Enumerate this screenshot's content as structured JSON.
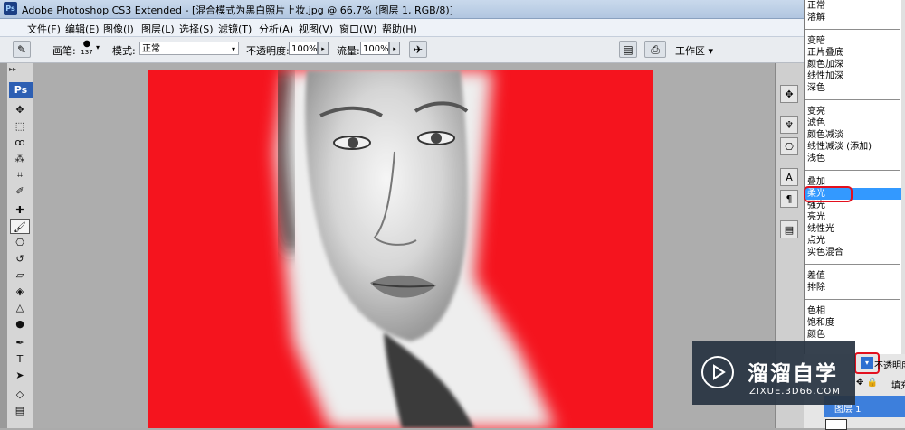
{
  "app": {
    "title": "Adobe Photoshop CS3 Extended - [混合模式为黑白照片上妆.jpg @ 66.7% (图层 1, RGB/8)]",
    "icon_text": "Ps"
  },
  "menu": [
    "文件(F)",
    "编辑(E)",
    "图像(I)",
    "图层(L)",
    "选择(S)",
    "滤镜(T)",
    "分析(A)",
    "视图(V)",
    "窗口(W)",
    "帮助(H)"
  ],
  "options": {
    "brush_label": "画笔:",
    "brush_size": "137",
    "mode_label": "模式:",
    "mode_value": "正常",
    "opacity_label": "不透明度:",
    "opacity_value": "100%",
    "flow_label": "流量:",
    "flow_value": "100%",
    "workspace_label": "工作区 ▾"
  },
  "toolbox": {
    "logo": "Ps",
    "tools": [
      {
        "name": "move-tool-icon",
        "glyph": "✥"
      },
      {
        "name": "marquee-tool-icon",
        "glyph": "⬚"
      },
      {
        "name": "lasso-tool-icon",
        "glyph": "ꝏ"
      },
      {
        "name": "magic-wand-icon",
        "glyph": "⁂"
      },
      {
        "name": "crop-tool-icon",
        "glyph": "⌗"
      },
      {
        "name": "slice-tool-icon",
        "glyph": "✐"
      },
      {
        "name": "healing-brush-icon",
        "glyph": "✚"
      },
      {
        "name": "brush-tool-icon",
        "glyph": "🖌",
        "active": true
      },
      {
        "name": "clone-stamp-icon",
        "glyph": "⎔"
      },
      {
        "name": "history-brush-icon",
        "glyph": "↺"
      },
      {
        "name": "eraser-tool-icon",
        "glyph": "▱"
      },
      {
        "name": "paint-bucket-icon",
        "glyph": "◈"
      },
      {
        "name": "blur-tool-icon",
        "glyph": "△"
      },
      {
        "name": "dodge-tool-icon",
        "glyph": "●"
      },
      {
        "name": "pen-tool-icon",
        "glyph": "✒"
      },
      {
        "name": "type-tool-icon",
        "glyph": "T"
      },
      {
        "name": "path-select-icon",
        "glyph": "➤"
      },
      {
        "name": "shape-tool-icon",
        "glyph": "◇"
      },
      {
        "name": "notes-tool-icon",
        "glyph": "▤"
      }
    ]
  },
  "blend_modes": {
    "groups": [
      [
        "正常",
        "溶解"
      ],
      [
        "变暗",
        "正片叠底",
        "颜色加深",
        "线性加深",
        "深色"
      ],
      [
        "变亮",
        "滤色",
        "颜色减淡",
        "线性减淡 (添加)",
        "浅色"
      ],
      [
        "叠加",
        "柔光",
        "强光",
        "亮光",
        "线性光",
        "点光",
        "实色混合"
      ],
      [
        "差值",
        "排除"
      ],
      [
        "色相",
        "饱和度",
        "颜色"
      ]
    ],
    "selected": "柔光"
  },
  "layers": {
    "opacity_label": "不透明度",
    "fill_label": "填充",
    "layer_name": "图层 1"
  },
  "watermark": {
    "title": "溜溜自学",
    "subtitle": "ZIXUE.3D66.COM"
  },
  "colors": {
    "canvas_red": "#f5141e",
    "selection_blue": "#3399ff",
    "highlight_red": "#e3101e"
  }
}
